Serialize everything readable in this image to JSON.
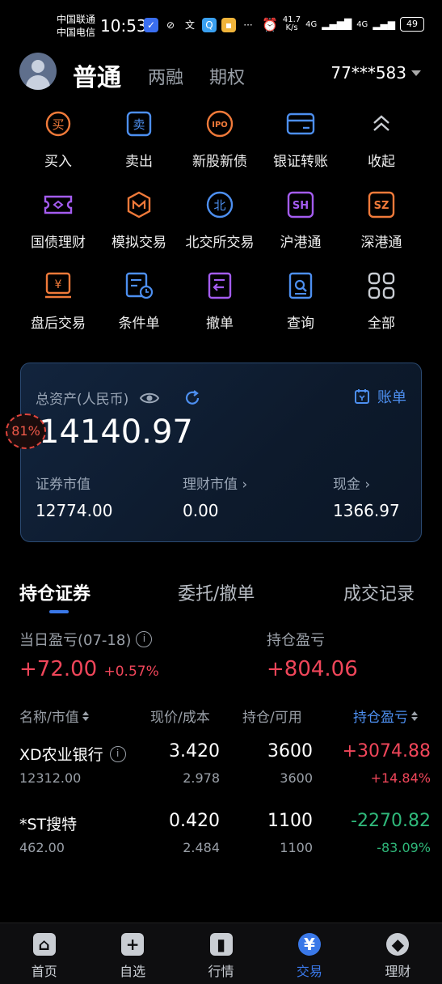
{
  "status_bar": {
    "carrier1": "中国联通",
    "carrier2": "中国电信",
    "time": "10:53",
    "net_speed_value": "41.7",
    "net_speed_unit": "K/s",
    "signal1": "4G",
    "signal2": "4G",
    "battery": "49"
  },
  "header": {
    "tabs": [
      "普通",
      "两融",
      "期权"
    ],
    "active_tab": "普通",
    "account": "77***583"
  },
  "grid": [
    {
      "label": "买入",
      "icon": "buy-icon",
      "color": "#f07a3a"
    },
    {
      "label": "卖出",
      "icon": "sell-icon",
      "color": "#4d8ff0"
    },
    {
      "label": "新股新债",
      "icon": "ipo-icon",
      "color": "#f07a3a"
    },
    {
      "label": "银证转账",
      "icon": "bank-card-icon",
      "color": "#4d8ff0"
    },
    {
      "label": "收起",
      "icon": "collapse-icon",
      "color": "#c9cdd3"
    },
    {
      "label": "国债理财",
      "icon": "ticket-icon",
      "color": "#a45cf0"
    },
    {
      "label": "模拟交易",
      "icon": "simulation-icon",
      "color": "#f07a3a"
    },
    {
      "label": "北交所交易",
      "icon": "bse-icon",
      "color": "#4d8ff0"
    },
    {
      "label": "沪港通",
      "icon": "sh-icon",
      "color": "#a45cf0"
    },
    {
      "label": "深港通",
      "icon": "sz-icon",
      "color": "#f07a3a"
    },
    {
      "label": "盘后交易",
      "icon": "after-hours-icon",
      "color": "#f07a3a"
    },
    {
      "label": "条件单",
      "icon": "condition-order-icon",
      "color": "#4d8ff0"
    },
    {
      "label": "撤单",
      "icon": "cancel-order-icon",
      "color": "#a45cf0"
    },
    {
      "label": "查询",
      "icon": "query-icon",
      "color": "#4d8ff0"
    },
    {
      "label": "全部",
      "icon": "all-icon",
      "color": "#c9cdd3"
    }
  ],
  "asset": {
    "label": "总资产(人民币)",
    "ledger": "账单",
    "total": "14140.97",
    "securities_label": "证券市值",
    "securities_value": "12774.00",
    "wealth_label": "理财市值",
    "wealth_value": "0.00",
    "cash_label": "现金",
    "cash_value": "1366.97",
    "overlay_percent": "81%"
  },
  "tabs": [
    "持仓证券",
    "委托/撤单",
    "成交记录"
  ],
  "pl": {
    "daily_label": "当日盈亏(07-18)",
    "daily_value": "+72.00",
    "daily_pct": "+0.57%",
    "holding_label": "持仓盈亏",
    "holding_value": "+804.06"
  },
  "columns": [
    "名称/市值",
    "现价/成本",
    "持仓/可用",
    "持仓盈亏"
  ],
  "holdings": [
    {
      "name": "XD农业银行",
      "market_value": "12312.00",
      "price": "3.420",
      "cost": "2.978",
      "qty": "3600",
      "avail": "3600",
      "pl": "+3074.88",
      "pct": "+14.84%",
      "sign": "pos"
    },
    {
      "name": "*ST搜特",
      "market_value": "462.00",
      "price": "0.420",
      "cost": "2.484",
      "qty": "1100",
      "avail": "1100",
      "pl": "-2270.82",
      "pct": "-83.09%",
      "sign": "neg"
    }
  ],
  "nav": [
    {
      "label": "首页",
      "icon": "home-icon"
    },
    {
      "label": "自选",
      "icon": "watchlist-icon"
    },
    {
      "label": "行情",
      "icon": "market-icon"
    },
    {
      "label": "交易",
      "icon": "trade-icon",
      "active": true
    },
    {
      "label": "理财",
      "icon": "wealth-icon"
    }
  ],
  "colors": {
    "accent": "#3a78e8",
    "up": "#f0465a",
    "down": "#2fb87a"
  }
}
